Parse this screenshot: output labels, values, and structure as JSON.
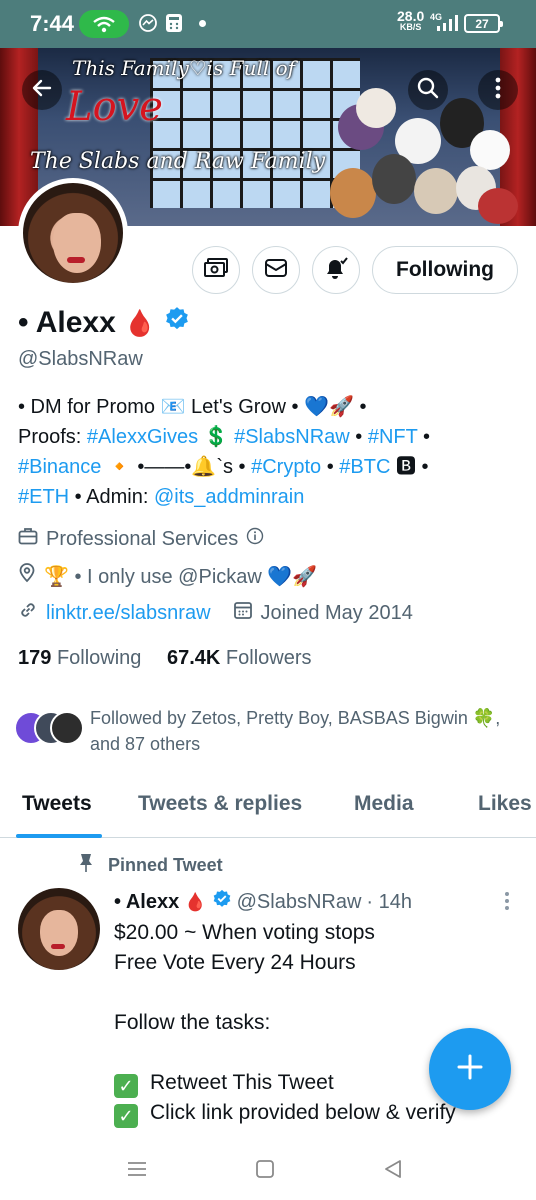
{
  "status_bar": {
    "time": "7:44",
    "net_speed": "28.0",
    "net_speed_unit": "KB/S",
    "network": "4G",
    "battery": "27"
  },
  "banner": {
    "title_line": "This Family♡is Full of",
    "love_text": "Love",
    "subtitle": "The Slabs and Raw Family"
  },
  "profile": {
    "name": "• Alexx",
    "name_emoji": "🩸",
    "handle": "@SlabsNRaw",
    "follow_button": "Following",
    "bio": {
      "line1_text": "• DM for Promo 📧 Let's Grow • 💙🚀 •",
      "line2_prefix": "Proofs: ",
      "line2_tag1": "#AlexxGives",
      "line2_sep1": " 💲 ",
      "line2_tag2": "#SlabsNRaw",
      "line2_sep2": " • ",
      "line2_tag3": "#NFT",
      "line2_suffix": " •",
      "line3_tag1": "#Binance",
      "line3_mid": " 🔸 •——•🔔`s • ",
      "line3_tag2": "#Crypto",
      "line3_sep": " • ",
      "line3_tag3": "#BTC",
      "line3_suffix": " 🅱 •",
      "line4_tag1": "#ETH",
      "line4_mid": " • Admin: ",
      "line4_mention": "@its_addminrain"
    },
    "category": "Professional Services",
    "location": "🏆 • I only use @Pickaw 💙🚀",
    "website": "linktr.ee/slabsnraw",
    "joined": "Joined May 2014",
    "following_count": "179",
    "following_label": "Following",
    "followers_count": "67.4K",
    "followers_label": "Followers",
    "followed_by": "Followed by Zetos, Pretty Boy, BASBAS Bigwin 🍀, and 87 others"
  },
  "tabs": [
    "Tweets",
    "Tweets & replies",
    "Media",
    "Likes"
  ],
  "pinned_tweet": {
    "pinned_label": "Pinned Tweet",
    "author_name": "• Alexx",
    "author_emoji": "🩸",
    "author_handle": "@SlabsNRaw",
    "time": "· 14h",
    "lines": [
      "$20.00 ~ When voting stops",
      "Free Vote Every 24 Hours",
      "",
      "Follow the tasks:",
      ""
    ],
    "tasks": [
      "Retweet This Tweet",
      "Click link provided below & verify"
    ]
  },
  "colors": {
    "accent": "#1d9bf0",
    "status_bar": "#4d7d7c",
    "text_primary": "#0f1419",
    "text_secondary": "#536471"
  }
}
